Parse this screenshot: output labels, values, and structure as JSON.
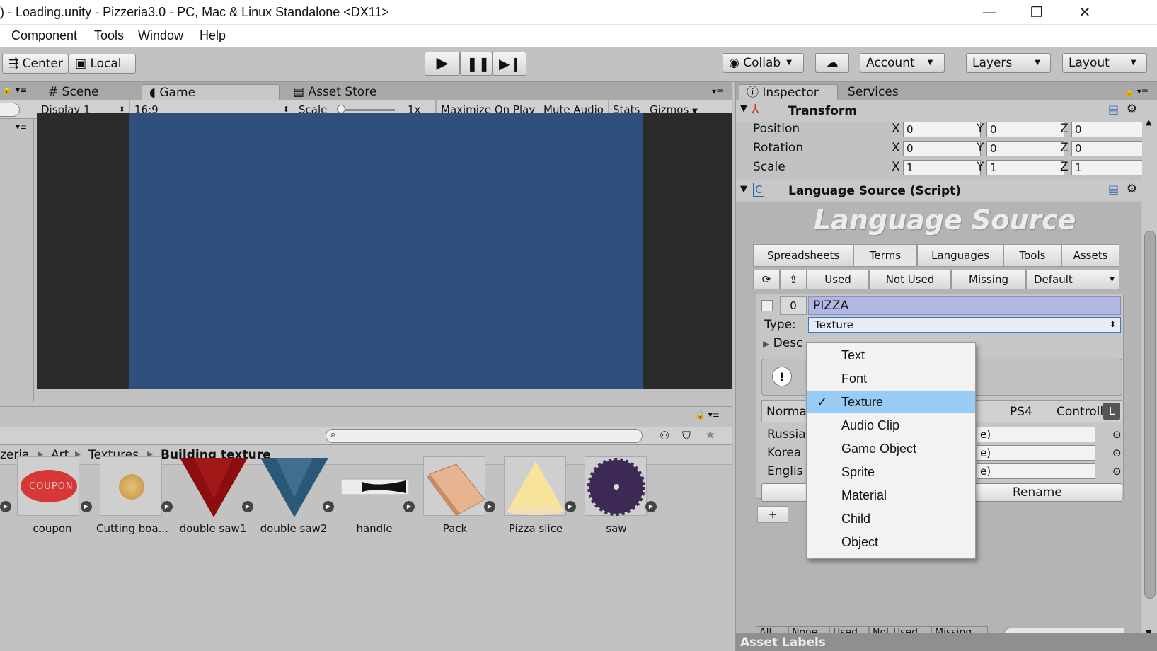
{
  "window": {
    "title": ") - Loading.unity - Pizzeria3.0 - PC, Mac & Linux Standalone <DX11>",
    "minimize_glyph": "—",
    "restore_glyph": "❐",
    "close_glyph": "✕"
  },
  "menubar": {
    "items": [
      "Component",
      "Tools",
      "Window",
      "Help"
    ]
  },
  "toolbar": {
    "center_label": "Center",
    "local_label": "Local",
    "collab_label": "Collab",
    "account_label": "Account",
    "layers_label": "Layers",
    "layout_label": "Layout"
  },
  "scene_panel": {
    "tabs": [
      "Scene",
      "Game",
      "Asset Store"
    ],
    "display": "Display 1",
    "aspect": "16:9",
    "scale_label": "Scale",
    "scale_value": "1x",
    "options": [
      "Maximize On Play",
      "Mute Audio",
      "Stats",
      "Gizmos"
    ],
    "game_view_color": "#2f4f7c"
  },
  "project_panel": {
    "breadcrumb": [
      "zeria",
      "Art",
      "Textures",
      "Building texture"
    ],
    "assets": [
      "coupon",
      "Cutting boa...",
      "double saw1",
      "double saw2",
      "handle",
      "Pack",
      "Pizza slice",
      "saw"
    ],
    "coupon_text": "COUPON"
  },
  "inspector": {
    "tabs": [
      "Inspector",
      "Services"
    ],
    "transform": {
      "title": "Transform",
      "rows": [
        {
          "label": "Position",
          "x": "0",
          "y": "0",
          "z": "0"
        },
        {
          "label": "Rotation",
          "x": "0",
          "y": "0",
          "z": "0"
        },
        {
          "label": "Scale",
          "x": "1",
          "y": "1",
          "z": "1"
        }
      ]
    },
    "script_title": "Language Source (Script)",
    "banner": "Language Source",
    "main_tabs": [
      "Spreadsheets",
      "Terms",
      "Languages",
      "Tools",
      "Assets"
    ],
    "filter_tabs": [
      "Used",
      "Not Used",
      "Missing",
      "Default"
    ],
    "term": {
      "count": "0",
      "key": "PIZZA"
    },
    "type_label": "Type:",
    "type_value": "Texture",
    "desc_label": "Desc",
    "norm_label": "Norma",
    "ps4_label": "PS4",
    "controller_label": "Controller",
    "l_label": "L",
    "languages": [
      "Russia",
      "Korea",
      "Englis"
    ],
    "rename_label": "Rename",
    "plus_label": "+",
    "bottom_tabs": [
      "All",
      "None",
      "Used",
      "Not Used",
      "Missing"
    ],
    "asset_labels": "Asset Labels"
  },
  "type_dropdown": {
    "items": [
      "Text",
      "Font",
      "Texture",
      "Audio Clip",
      "Game Object",
      "Sprite",
      "Material",
      "Child",
      "Object"
    ],
    "selected": "Texture",
    "check": "✓"
  }
}
